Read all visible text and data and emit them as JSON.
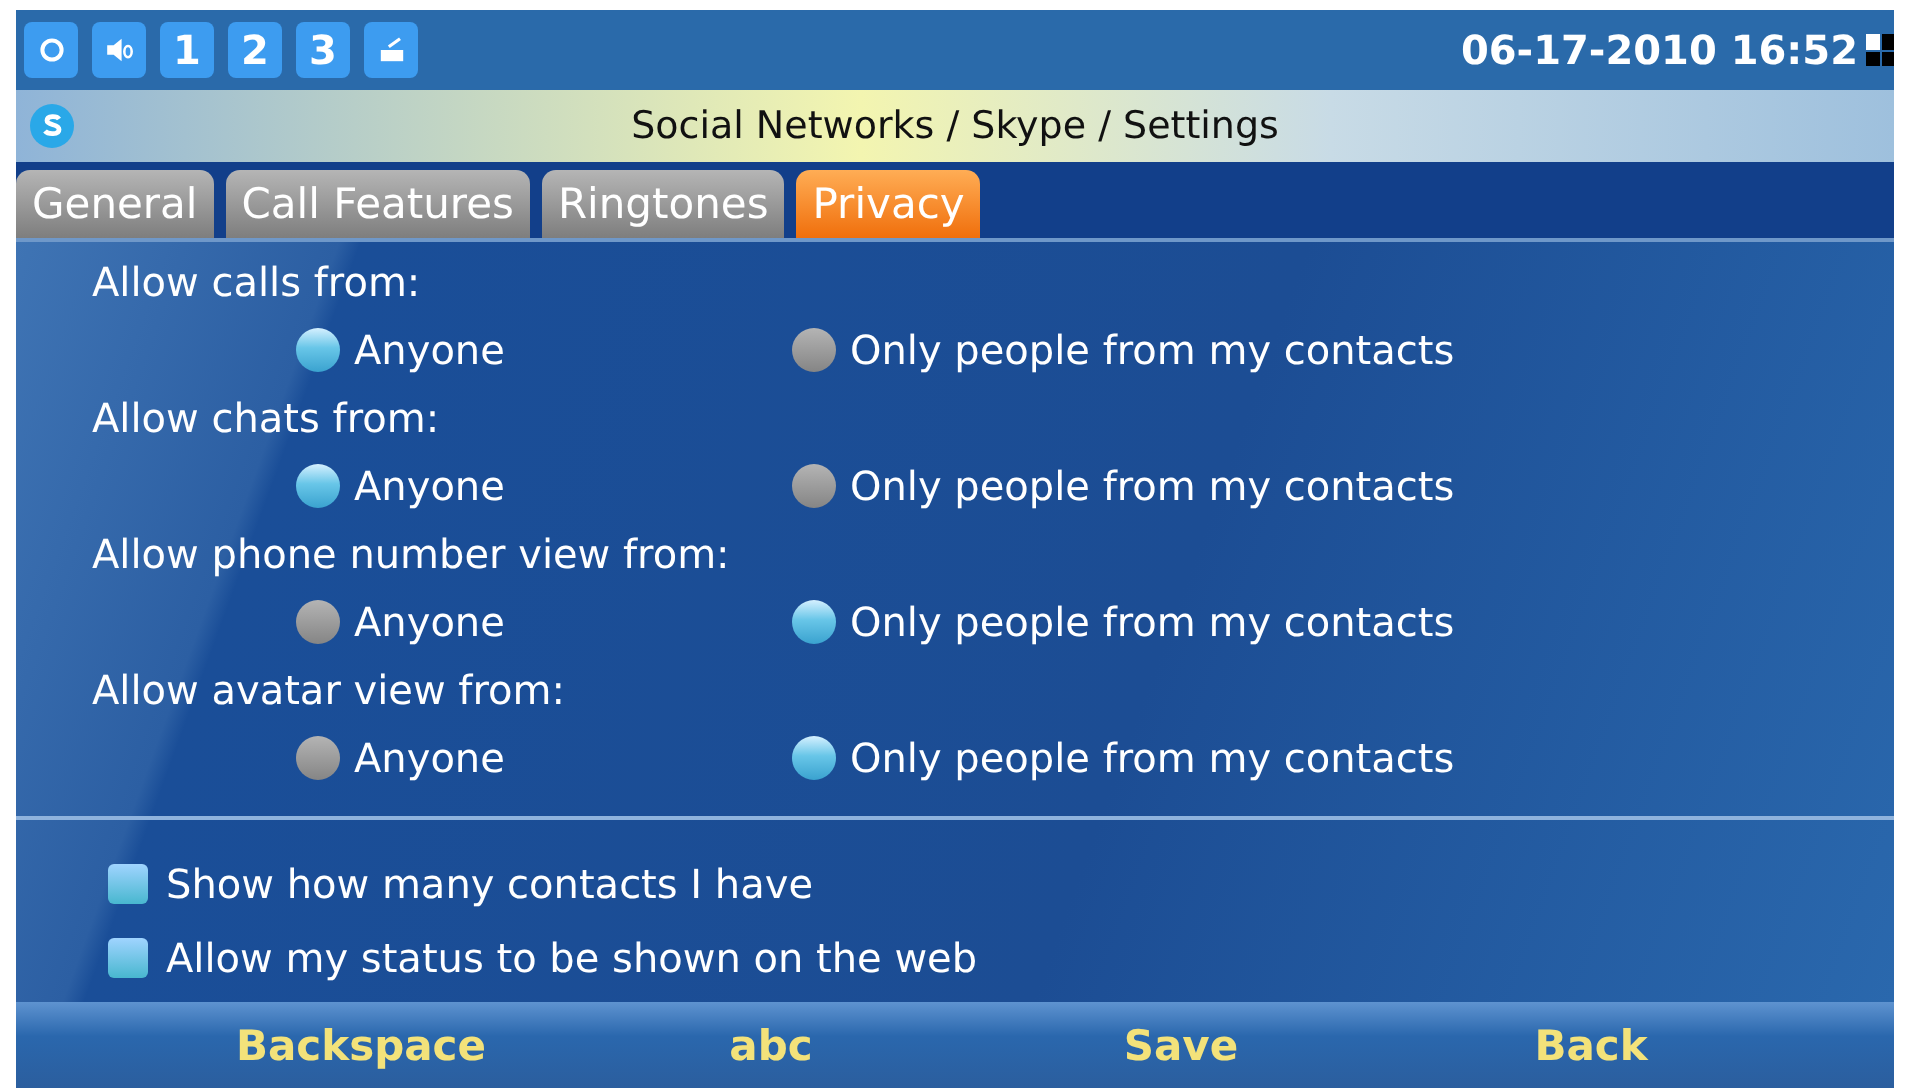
{
  "status_bar": {
    "indicators": [
      {
        "kind": "sync"
      },
      {
        "kind": "speaker"
      },
      {
        "kind": "number",
        "label": "1"
      },
      {
        "kind": "number",
        "label": "2"
      },
      {
        "kind": "number",
        "label": "3"
      },
      {
        "kind": "tray"
      }
    ],
    "datetime": "06-17-2010 16:52"
  },
  "title_bar": {
    "title": "Social Networks / Skype / Settings"
  },
  "tabs": [
    {
      "label": "General",
      "selected": false
    },
    {
      "label": "Call Features",
      "selected": false
    },
    {
      "label": "Ringtones",
      "selected": false
    },
    {
      "label": "Privacy",
      "selected": true
    }
  ],
  "radio_groups": [
    {
      "label": "Allow calls from:",
      "options": [
        {
          "label": "Anyone",
          "selected": true
        },
        {
          "label": "Only people from my contacts",
          "selected": false
        }
      ]
    },
    {
      "label": "Allow chats from:",
      "options": [
        {
          "label": "Anyone",
          "selected": true
        },
        {
          "label": "Only people from my contacts",
          "selected": false
        }
      ]
    },
    {
      "label": "Allow phone number view from:",
      "options": [
        {
          "label": "Anyone",
          "selected": false
        },
        {
          "label": "Only people from my contacts",
          "selected": true
        }
      ]
    },
    {
      "label": "Allow avatar view from:",
      "options": [
        {
          "label": "Anyone",
          "selected": false
        },
        {
          "label": "Only people from my contacts",
          "selected": true
        }
      ]
    }
  ],
  "checkboxes": [
    {
      "label": "Show how many contacts I have",
      "checked": true
    },
    {
      "label": "Allow my status to be shown on the web",
      "checked": true
    }
  ],
  "softkeys": [
    "Backspace",
    "abc",
    "Save",
    "Back"
  ]
}
